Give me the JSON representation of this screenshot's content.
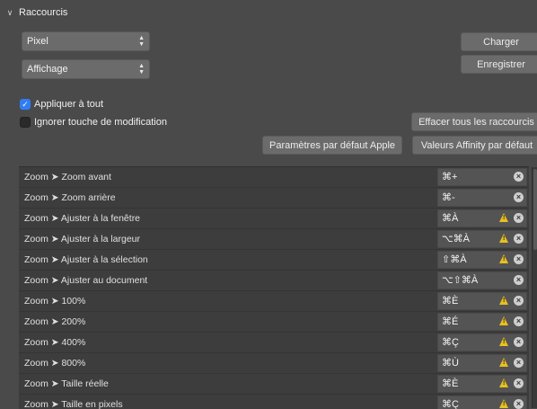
{
  "section": {
    "title": "Raccourcis"
  },
  "selects": {
    "persona": "Pixel",
    "category": "Affichage"
  },
  "buttons": {
    "load": "Charger",
    "save": "Enregistrer",
    "clear_all": "Effacer tous les raccourcis",
    "apple_defaults": "Paramètres par défaut Apple",
    "affinity_defaults": "Valeurs Affinity par défaut"
  },
  "checkboxes": {
    "apply_all": {
      "label": "Appliquer à tout",
      "checked": true
    },
    "ignore_modifier": {
      "label": "Ignorer touche de modification",
      "checked": false
    }
  },
  "shortcuts": [
    {
      "name": "Zoom ➤ Zoom avant",
      "keys": "⌘+",
      "warning": false
    },
    {
      "name": "Zoom ➤ Zoom arrière",
      "keys": "⌘-",
      "warning": false
    },
    {
      "name": "Zoom ➤ Ajuster à la fenêtre",
      "keys": "⌘À",
      "warning": true
    },
    {
      "name": "Zoom ➤ Ajuster à la largeur",
      "keys": "⌥⌘À",
      "warning": true
    },
    {
      "name": "Zoom ➤ Ajuster à la sélection",
      "keys": "⇧⌘À",
      "warning": true
    },
    {
      "name": "Zoom ➤ Ajuster au document",
      "keys": "⌥⇧⌘À",
      "warning": false
    },
    {
      "name": "Zoom ➤ 100%",
      "keys": "⌘È",
      "warning": true
    },
    {
      "name": "Zoom ➤ 200%",
      "keys": "⌘É",
      "warning": true
    },
    {
      "name": "Zoom ➤ 400%",
      "keys": "⌘Ç",
      "warning": true
    },
    {
      "name": "Zoom ➤ 800%",
      "keys": "⌘Ù",
      "warning": true
    },
    {
      "name": "Zoom ➤ Taille réelle",
      "keys": "⌘È",
      "warning": true
    },
    {
      "name": "Zoom ➤ Taille en pixels",
      "keys": "⌘Ç",
      "warning": true
    }
  ],
  "colors": {
    "checkbox_on": "#2f7ef6",
    "warning": "#e8c020",
    "background": "#4a4a4a"
  }
}
